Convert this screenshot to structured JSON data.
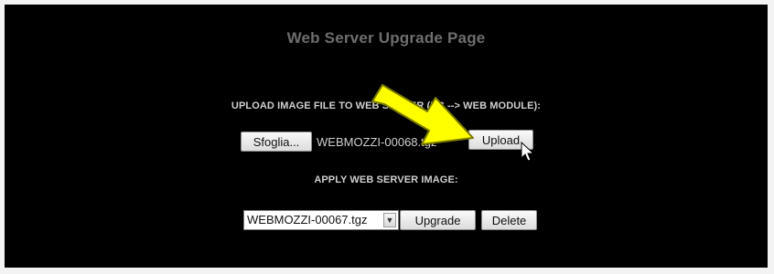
{
  "page": {
    "title": "Web Server Upgrade Page"
  },
  "upload_section": {
    "label": "UPLOAD IMAGE FILE TO WEB SERVER (PC --> WEB MODULE):",
    "browse_label": "Sfoglia...",
    "selected_file": "WEBMOZZI-00068.tgz",
    "upload_label": "Upload"
  },
  "apply_section": {
    "label": "APPLY WEB SERVER IMAGE:",
    "selected_image": "WEBMOZZI-00067.tgz",
    "upgrade_label": "Upgrade",
    "delete_label": "Delete"
  },
  "annotation": {
    "arrow_color": "#ffff00",
    "arrow_outline": "#7a7a00",
    "icon": "arrow-icon",
    "cursor_icon": "mouse-cursor-icon"
  },
  "colors": {
    "panel": "#000000",
    "title": "#6e6e6e",
    "labels": "#cfcfcf"
  }
}
